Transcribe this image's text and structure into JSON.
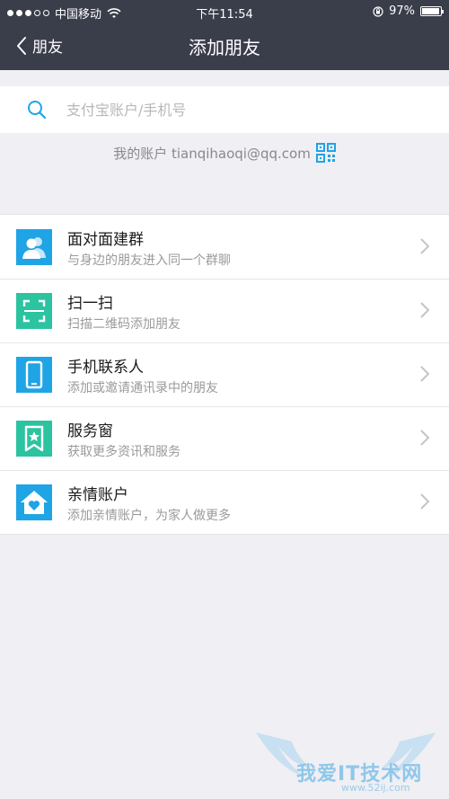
{
  "status_bar": {
    "carrier": "中国移动",
    "time": "下午11:54",
    "battery": "97%",
    "battery_level": 0.97
  },
  "nav": {
    "back_label": "朋友",
    "title": "添加朋友"
  },
  "search": {
    "placeholder": "支付宝账户/手机号"
  },
  "account": {
    "text": "我的账户 tianqihaoqi@qq.com"
  },
  "items": [
    {
      "title": "面对面建群",
      "subtitle": "与身边的朋友进入同一个群聊",
      "icon": "people-icon",
      "color": "#1fa4e6"
    },
    {
      "title": "扫一扫",
      "subtitle": "扫描二维码添加朋友",
      "icon": "scan-icon",
      "color": "#2cc3a0"
    },
    {
      "title": "手机联系人",
      "subtitle": "添加或邀请通讯录中的朋友",
      "icon": "phone-icon",
      "color": "#1fa4e6"
    },
    {
      "title": "服务窗",
      "subtitle": "获取更多资讯和服务",
      "icon": "bookmark-star-icon",
      "color": "#2cc3a0"
    },
    {
      "title": "亲情账户",
      "subtitle": "添加亲情账户，为家人做更多",
      "icon": "home-heart-icon",
      "color": "#1fa4e6"
    }
  ],
  "watermark": {
    "text": "我爱IT技术网",
    "url": "www.52ij.com"
  }
}
